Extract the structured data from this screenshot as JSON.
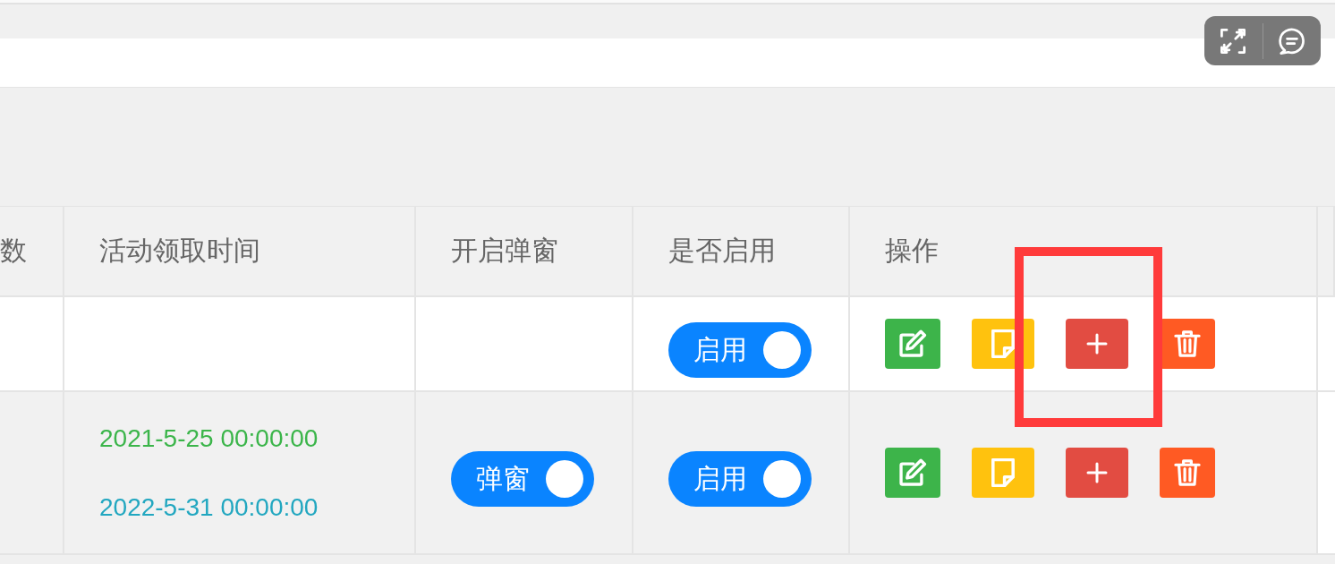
{
  "floating_toolbar": {
    "buttons": [
      {
        "kind": "expand"
      },
      {
        "kind": "chat"
      }
    ]
  },
  "table": {
    "columns": [
      "数",
      "活动领取时间",
      "开启弹窗",
      "是否启用",
      "操作"
    ],
    "rows": [
      {
        "enabled": {
          "label": "启用",
          "on": true
        },
        "actions": [
          {
            "kind": "edit",
            "highlighted": false
          },
          {
            "kind": "note",
            "highlighted": false
          },
          {
            "kind": "add",
            "highlighted": true
          },
          {
            "kind": "delete",
            "highlighted": false
          }
        ]
      },
      {
        "claim_time": {
          "start": "2021-5-25 00:00:00",
          "end": "2022-5-31 00:00:00"
        },
        "popup": {
          "label": "弹窗",
          "on": true
        },
        "enabled": {
          "label": "启用",
          "on": true
        },
        "actions": [
          {
            "kind": "edit",
            "highlighted": false
          },
          {
            "kind": "note",
            "highlighted": false
          },
          {
            "kind": "add",
            "highlighted": false
          },
          {
            "kind": "delete",
            "highlighted": false
          }
        ]
      }
    ]
  }
}
